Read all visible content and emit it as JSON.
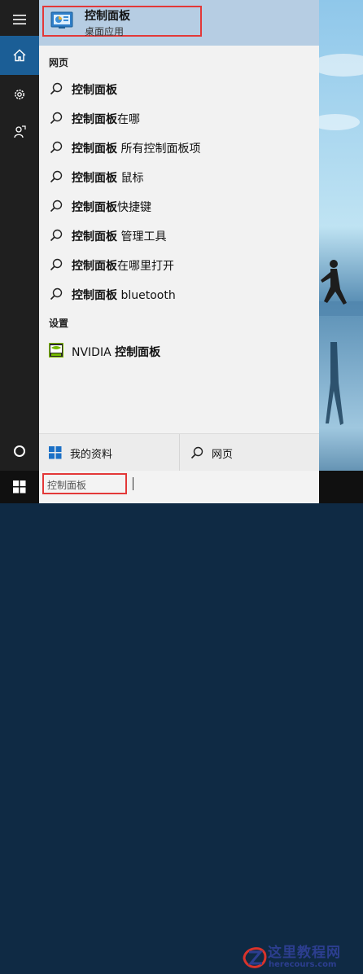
{
  "best_match": {
    "title": "控制面板",
    "subtitle": "桌面应用"
  },
  "sections": {
    "web": "网页",
    "settings": "设置"
  },
  "web_results": [
    {
      "bold": "控制面板",
      "rest": ""
    },
    {
      "bold": "控制面板",
      "rest": "在哪"
    },
    {
      "bold": "控制面板",
      "rest": " 所有控制面板项"
    },
    {
      "bold": "控制面板",
      "rest": " 鼠标"
    },
    {
      "bold": "控制面板",
      "rest": "快捷键"
    },
    {
      "bold": "控制面板",
      "rest": " 管理工具"
    },
    {
      "bold": "控制面板",
      "rest": "在哪里打开"
    },
    {
      "bold": "控制面板",
      "rest": " bluetooth"
    }
  ],
  "settings_result": {
    "prefix": "NVIDIA ",
    "bold": "控制面板"
  },
  "filters": {
    "my_stuff": "我的资料",
    "web": "网页"
  },
  "search": {
    "query": "控制面板"
  },
  "watermark": {
    "title": "这里教程网",
    "url": "herecours.com"
  },
  "colors": {
    "accent": "#1b5e96",
    "highlight": "#b6cde3",
    "annotation": "#e33838"
  },
  "icons": {
    "rail": [
      "hamburger-icon",
      "home-icon",
      "settings-gear-icon",
      "feedback-icon"
    ],
    "search": "magnifier-icon",
    "windows": "windows-logo-icon"
  }
}
